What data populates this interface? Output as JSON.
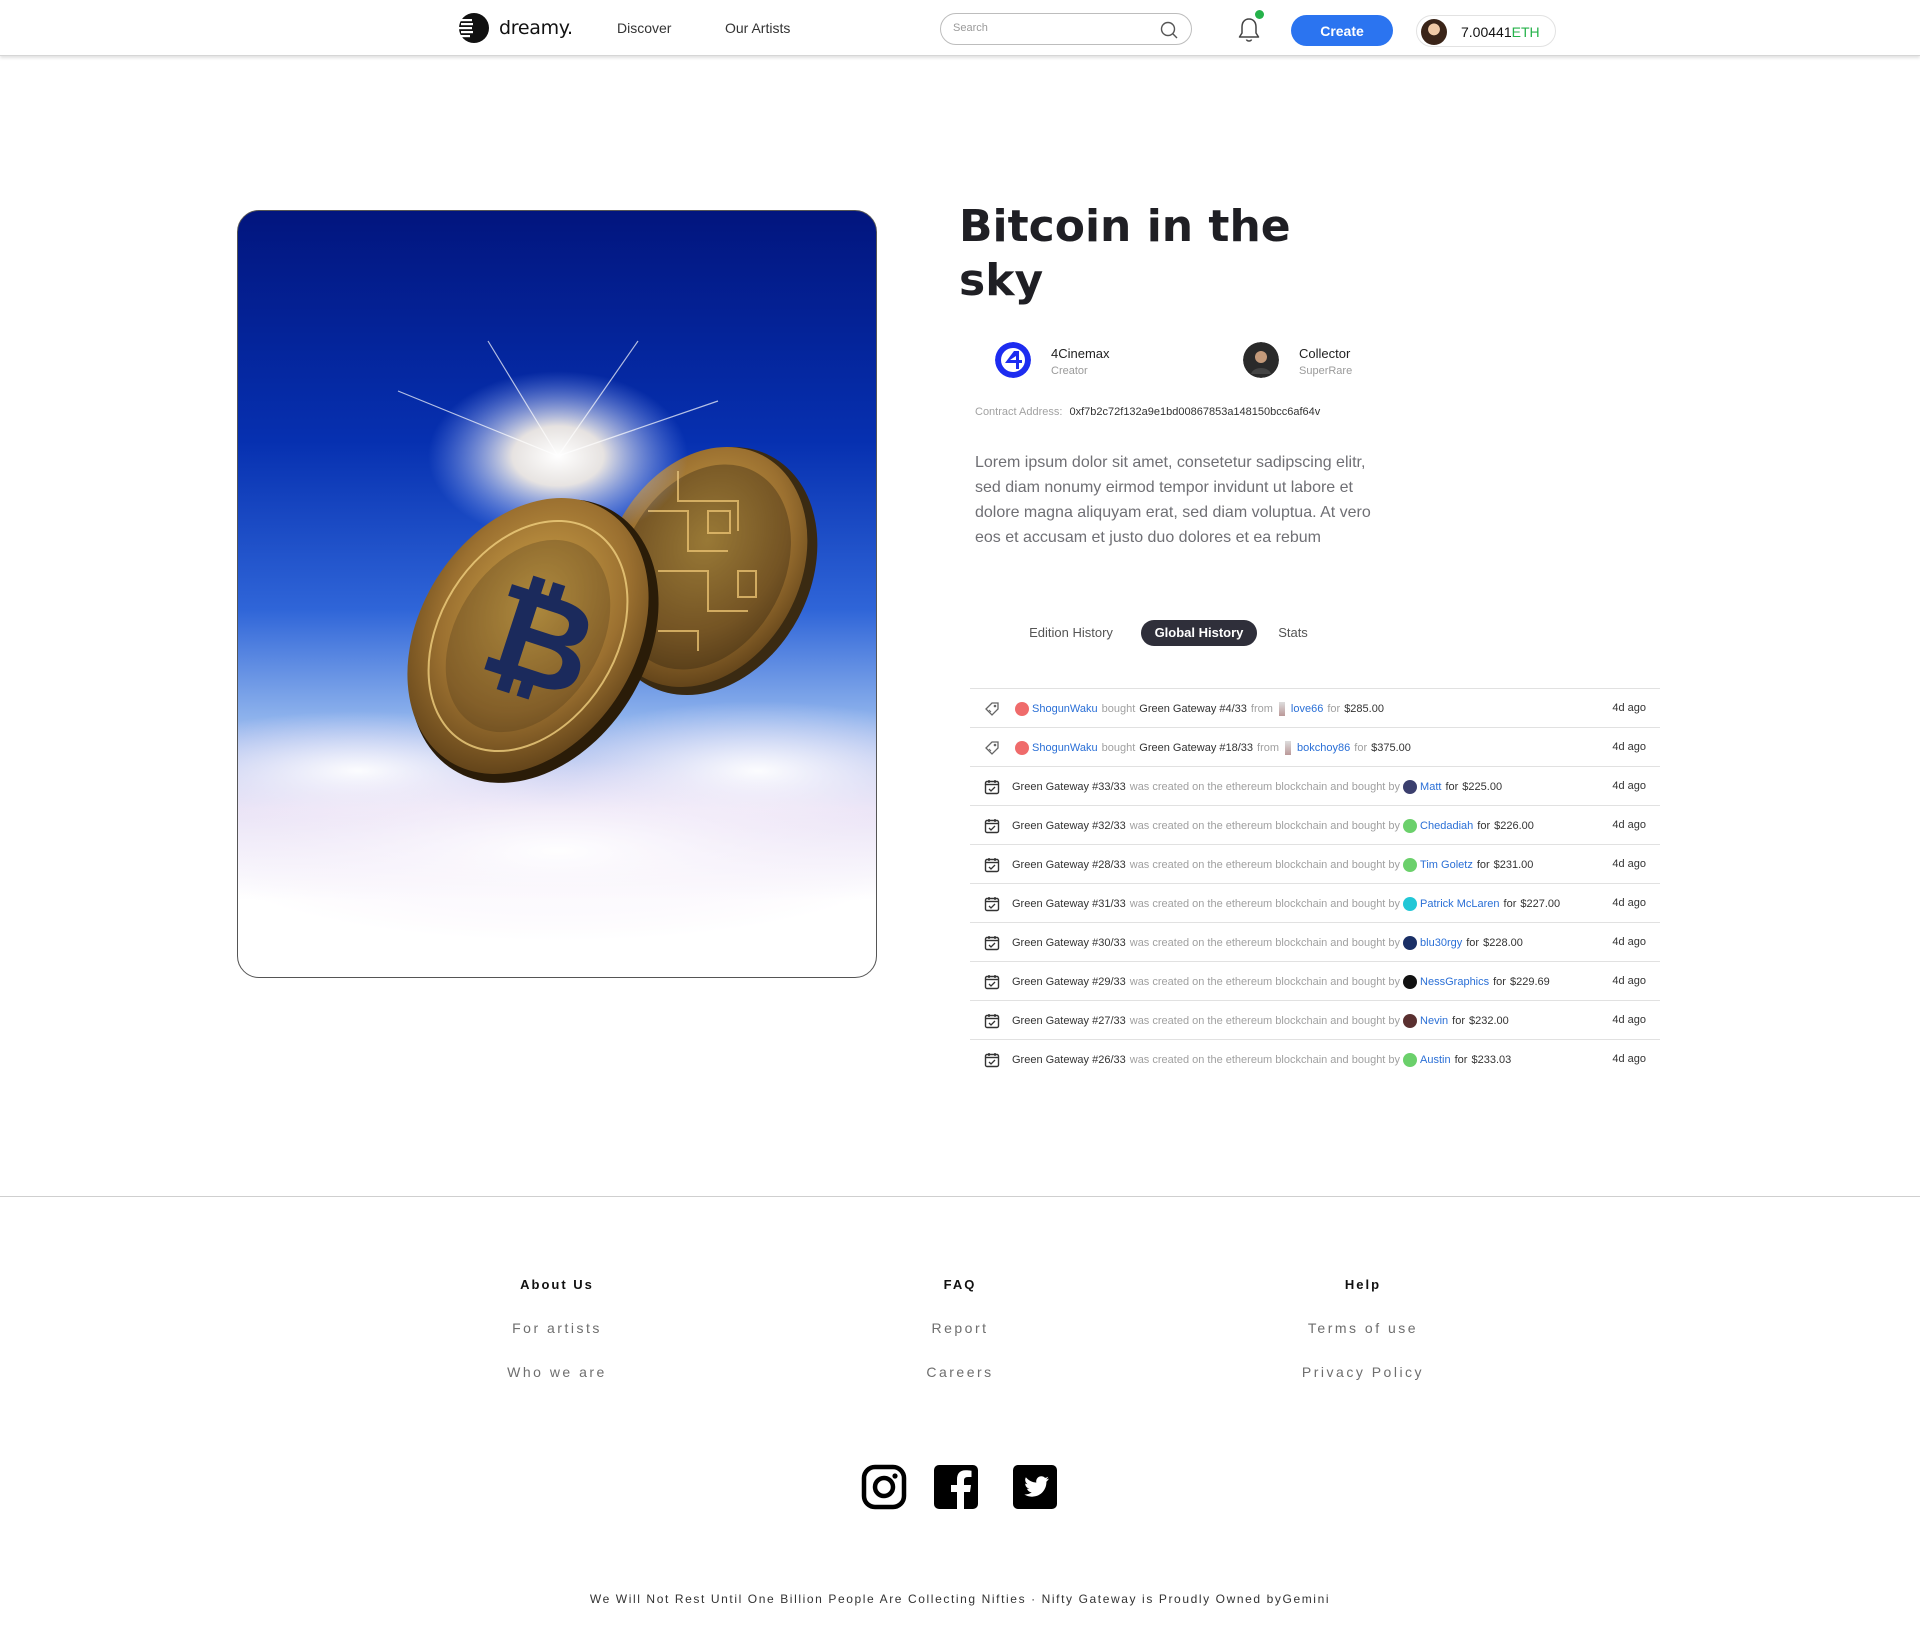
{
  "header": {
    "brand": "dreamy.",
    "nav": [
      "Discover",
      "Our Artists"
    ],
    "search_placeholder": "Search",
    "create_label": "Create",
    "wallet_amount": "7.00441",
    "wallet_unit": "ETH",
    "notification_dot_color": "#25b24a"
  },
  "artwork": {
    "title": "Bitcoin in the sky",
    "creator": {
      "name": "4Cinemax",
      "role": "Creator"
    },
    "collector": {
      "name": "Collector",
      "role": "SuperRare"
    },
    "contract_label": "Contract Address:",
    "contract_address": "0xf7b2c72f132a9e1bd00867853a148150bcc6af64v",
    "description": "Lorem ipsum dolor sit amet, consetetur sadipscing elitr, sed diam nonumy eirmod tempor invidunt ut labore et dolore magna aliquyam erat, sed diam voluptua. At vero eos et accusam et justo duo dolores et ea rebum"
  },
  "tabs": [
    "Edition History",
    "Global History",
    "Stats"
  ],
  "active_tab": "Global History",
  "history": [
    {
      "kind": "sale",
      "buyer": "ShogunWaku",
      "verb": "bought",
      "item": "Green Gateway #4/33",
      "from_word": "from",
      "seller": "love66",
      "for_word": "for",
      "price": "$285.00",
      "time": "4d ago"
    },
    {
      "kind": "sale",
      "buyer": "ShogunWaku",
      "verb": "bought",
      "item": "Green Gateway #18/33",
      "from_word": "from",
      "seller": "bokchoy86",
      "for_word": "for",
      "price": "$375.00",
      "time": "4d ago"
    },
    {
      "kind": "mint",
      "item": "Green Gateway #33/33",
      "middle": "was created on the ethereum blockchain and bought by",
      "buyer": "Matt",
      "for_word": "for",
      "price": "$225.00",
      "time": "4d ago",
      "avatar_color": "#3b3f6e"
    },
    {
      "kind": "mint",
      "item": "Green Gateway #32/33",
      "middle": "was created on the ethereum blockchain and bought by",
      "buyer": "Chedadiah",
      "for_word": "for",
      "price": "$226.00",
      "time": "4d ago",
      "avatar_color": "#6bd06b"
    },
    {
      "kind": "mint",
      "item": "Green Gateway #28/33",
      "middle": "was created on the ethereum blockchain and bought by",
      "buyer": "Tim Goletz",
      "for_word": "for",
      "price": "$231.00",
      "time": "4d ago",
      "avatar_color": "#6bd06b"
    },
    {
      "kind": "mint",
      "item": "Green Gateway #31/33",
      "middle": "was created on the ethereum blockchain and bought by",
      "buyer": "Patrick McLaren",
      "for_word": "for",
      "price": "$227.00",
      "time": "4d ago",
      "avatar_color": "#22c7d6"
    },
    {
      "kind": "mint",
      "item": "Green Gateway #30/33",
      "middle": "was created on the ethereum blockchain and bought by",
      "buyer": "blu30rgy",
      "for_word": "for",
      "price": "$228.00",
      "time": "4d ago",
      "avatar_color": "#1a2f66"
    },
    {
      "kind": "mint",
      "item": "Green Gateway #29/33",
      "middle": "was created on the ethereum blockchain and bought by",
      "buyer": "NessGraphics",
      "for_word": "for",
      "price": "$229.69",
      "time": "4d ago",
      "avatar_color": "#111111"
    },
    {
      "kind": "mint",
      "item": "Green Gateway #27/33",
      "middle": "was created on the ethereum blockchain and bought by",
      "buyer": "Nevin",
      "for_word": "for",
      "price": "$232.00",
      "time": "4d ago",
      "avatar_color": "#5a3030"
    },
    {
      "kind": "mint",
      "item": "Green Gateway #26/33",
      "middle": "was created on the ethereum blockchain and bought by",
      "buyer": "Austin",
      "for_word": "for",
      "price": "$233.03",
      "time": "4d ago",
      "avatar_color": "#6bd06b"
    }
  ],
  "footer": {
    "columns": [
      {
        "heading": "About Us",
        "links": [
          "For artists",
          "Who we are"
        ]
      },
      {
        "heading": "FAQ",
        "links": [
          "Report",
          "Careers"
        ]
      },
      {
        "heading": "Help",
        "links": [
          "Terms of use",
          "Privacy Policy"
        ]
      }
    ],
    "social_icons": [
      "instagram-icon",
      "facebook-icon",
      "twitter-icon"
    ],
    "tagline": "We Will Not Rest Until One Billion People Are Collecting Nifties · Nifty Gateway is Proudly Owned byGemini"
  },
  "colors": {
    "accent": "#2b74f0",
    "eth_green": "#25b24a",
    "link_blue": "#2a6fd6",
    "active_tab": "#2f2f3a"
  }
}
